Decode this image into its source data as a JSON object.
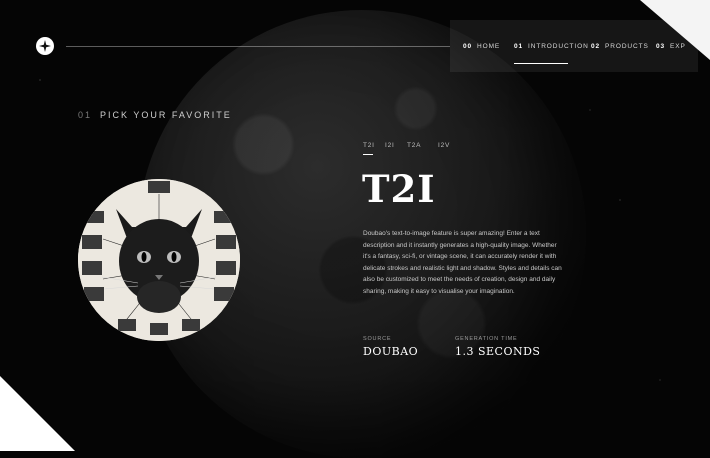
{
  "nav": {
    "items": [
      {
        "num": "00",
        "label": "HOME"
      },
      {
        "num": "01",
        "label": "INTRODUCTION"
      },
      {
        "num": "02",
        "label": "PRODUCTS"
      },
      {
        "num": "03",
        "label": "EXP"
      }
    ],
    "active_index": 1
  },
  "section": {
    "num": "01",
    "label": "PICK YOUR FAVORITE"
  },
  "tabs": [
    "T2I",
    "I2I",
    "T2A",
    "I2V"
  ],
  "active_tab": "T2I",
  "title": "T2I",
  "description": "Doubao's text-to-image feature is super amazing! Enter a text description and it instantly generates a high-quality image. Whether it's a fantasy, sci-fi, or vintage scene, it can accurately render it with delicate strokes and realistic light and shadow. Styles and details can also be customized to meet the needs of creation, design and daily sharing, making it easy to visualise your imagination.",
  "stats": [
    {
      "label": "SOURCE",
      "value": "DOUBAO"
    },
    {
      "label": "GENERATION TIME",
      "value": "1.3 SECONDS"
    }
  ],
  "colors": {
    "background": "#050505",
    "text": "#ffffff",
    "muted": "#9a9a9a"
  },
  "icons": {
    "logo": "compass-star-icon",
    "image": "cat-diagram-image"
  }
}
